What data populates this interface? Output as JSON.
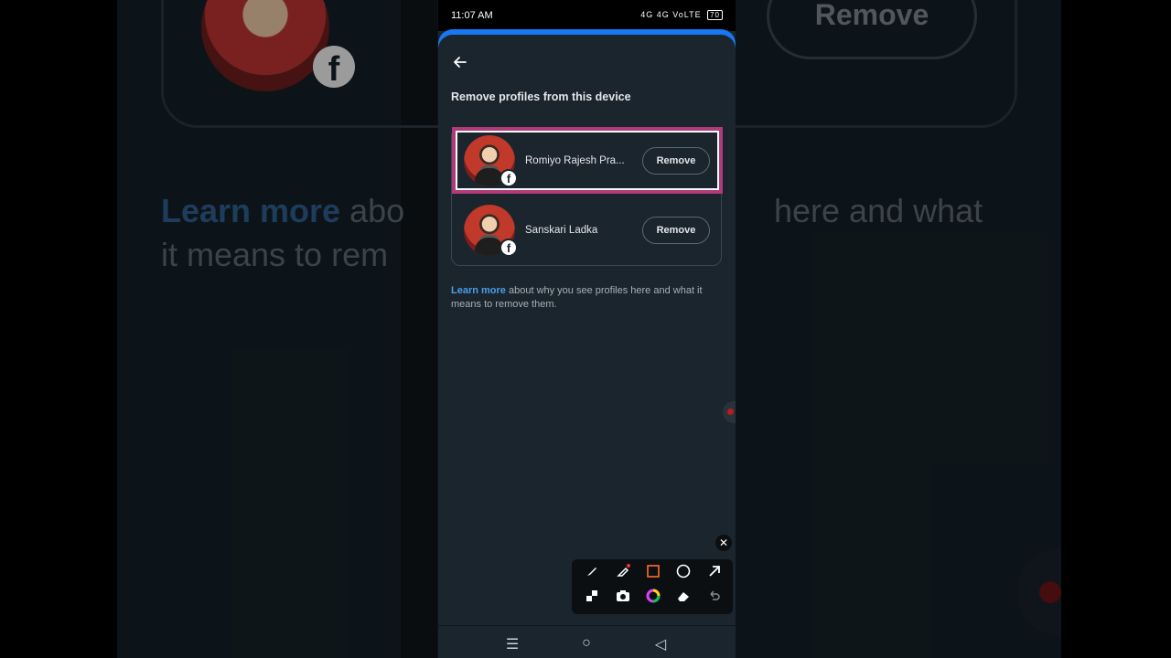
{
  "status_bar": {
    "time": "11:07 AM",
    "indicators": "4G 4G VoLTE",
    "battery": "70"
  },
  "screen": {
    "title": "Remove profiles from this device",
    "profiles": [
      {
        "name": "Romiyo Rajesh Pra...",
        "button": "Remove",
        "highlighted": true
      },
      {
        "name": "Sanskari Ladka",
        "button": "Remove",
        "highlighted": false
      }
    ],
    "info_link": "Learn more",
    "info_text": "about why you see profiles here and what it means to remove them."
  },
  "background": {
    "big_remove": "Remove",
    "big_link": "Learn more",
    "big_text_1": "abo",
    "big_text_2": "here and what",
    "big_text_3": "it means to rem"
  },
  "toolbox": {
    "tools": [
      "brush-icon",
      "marker-icon",
      "rectangle-icon",
      "circle-icon",
      "arrow-icon",
      "mosaic-icon",
      "camera-icon",
      "color-icon",
      "eraser-icon",
      "undo-icon"
    ],
    "accent_color": "#ff6d2d"
  },
  "colors": {
    "sheet_bg": "#1b252d",
    "link": "#4a9eea",
    "highlight": "#b03a7a",
    "fb_blue": "#1877f2"
  }
}
